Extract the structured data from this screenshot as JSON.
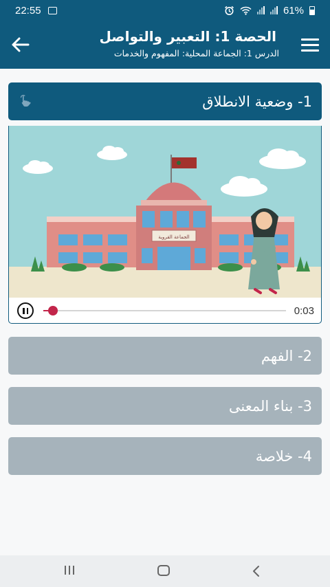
{
  "status_bar": {
    "time": "22:55",
    "battery": "61%"
  },
  "app_bar": {
    "title": "الحصة 1: التعبير والتواصل",
    "subtitle": "الدرس 1: الجماعة المحلية: المفهوم والخدمات"
  },
  "sections": [
    {
      "label": "1- وضعية الانطلاق"
    },
    {
      "label": "2- الفهم"
    },
    {
      "label": "3- بناء المعنى"
    },
    {
      "label": "4- خلاصة"
    }
  ],
  "video": {
    "building_sign": "الجماعة القروية",
    "elapsed": "0:03",
    "progress": 0.04
  },
  "colors": {
    "primary": "#0f5a7d",
    "collapsed": "#a6b3bb",
    "progress": "#c2254a"
  },
  "icons": [
    "image-icon",
    "alarm-icon",
    "wifi-icon",
    "signal-icon",
    "battery-icon",
    "back-arrow-icon",
    "menu-icon",
    "hand-tap-icon",
    "pause-icon",
    "recent-apps-icon",
    "home-icon",
    "system-back-icon"
  ]
}
